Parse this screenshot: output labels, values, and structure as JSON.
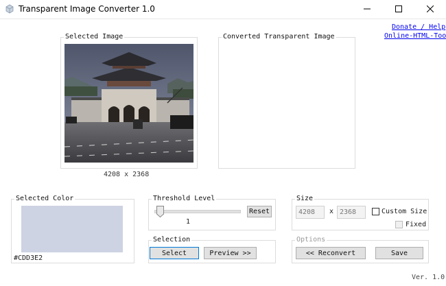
{
  "window": {
    "title": "Transparent Image Converter 1.0",
    "controls": [
      "minimize",
      "maximize",
      "close"
    ]
  },
  "links": {
    "donate": "Donate / Help",
    "tools": "Online-HTML-Tools"
  },
  "selected_image": {
    "legend": "Selected Image",
    "dimensions": "4208 x 2368"
  },
  "converted_image": {
    "legend": "Converted Transparent Image"
  },
  "selected_color": {
    "legend": "Selected Color",
    "hex": "#CDD3E2",
    "swatch_color": "#cdd3e2"
  },
  "threshold": {
    "legend": "Threshold Level",
    "value": "1",
    "reset_label": "Reset",
    "level_fraction": 0.06
  },
  "selection": {
    "legend": "Selection",
    "select_label": "Select",
    "preview_label": "Preview >>"
  },
  "size": {
    "legend": "Size",
    "width": "4208",
    "separator": "x",
    "height": "2368",
    "custom_size_label": "Custom Size",
    "fixed_label": "Fixed"
  },
  "options": {
    "legend": "Options",
    "reconvert_label": "<< Reconvert",
    "save_label": "Save"
  },
  "version": "Ver. 1.0",
  "colors": {
    "accent": "#0078d7",
    "link": "#0000ee"
  }
}
